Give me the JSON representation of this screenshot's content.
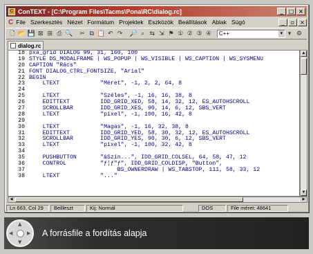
{
  "window": {
    "title": "ConTEXT - [C:\\Program Files\\Tacms\\Pona\\RC\\dialog.rc]",
    "controls": [
      "_",
      "□",
      "×"
    ],
    "doc_controls": [
      "_",
      "▫",
      "×"
    ]
  },
  "menu": {
    "logo": "C",
    "items": [
      "File",
      "Szerkesztés",
      "Nézet",
      "Formátum",
      "Projektek",
      "Eszközök",
      "Beállítások",
      "Ablak",
      "Súgó"
    ]
  },
  "toolbar": {
    "language": "C++"
  },
  "tab": {
    "label": "dialog.rc"
  },
  "code_lines": [
    {
      "n": "18",
      "t": "pxa_grid DIALOG 99, 31, 160, 100"
    },
    {
      "n": "19",
      "t": "STYLE DS_MODALFRAME | WS_POPUP | WS_VISIBLE | WS_CAPTION | WS_SYSMENU"
    },
    {
      "n": "20",
      "t": "CAPTION \"Rács\""
    },
    {
      "n": "21",
      "t": "FONT DIALOG_CTRL_FONTSIZE, \"Arial\""
    },
    {
      "n": "22",
      "t": "BEGIN"
    },
    {
      "n": "23",
      "t": "    LTEXT            \"Méret\", -1, 2, 2, 64, 8"
    },
    {
      "n": "24",
      "t": ""
    },
    {
      "n": "25",
      "t": "    LTEXT            \"Széles\", -1, 16, 16, 38, 8"
    },
    {
      "n": "26",
      "t": "    EDITTEXT         IDD_GRID_XED, 58, 14, 32, 12, ES_AUTOHSCROLL"
    },
    {
      "n": "27",
      "t": "    SCROLLBAR        IDD_GRID_XES, 90, 14, 6, 12, SBS_VERT"
    },
    {
      "n": "28",
      "t": "    LTEXT            \"pixel\", -1, 100, 16, 42, 8"
    },
    {
      "n": "29",
      "t": ""
    },
    {
      "n": "30",
      "t": "    LTEXT            \"Magas\", -1, 16, 32, 38, 8"
    },
    {
      "n": "31",
      "t": "    EDITTEXT         IDD_GRID_YED, 58, 30, 32, 12, ES_AUTOHSCROLL"
    },
    {
      "n": "32",
      "t": "    SCROLLBAR        IDD_GRID_YES, 90, 30, 6, 12, SBS_VERT"
    },
    {
      "n": "33",
      "t": "    LTEXT            \"pixel\", -1, 100, 32, 42, 8"
    },
    {
      "n": "34",
      "t": ""
    },
    {
      "n": "35",
      "t": "    PUSHBUTTON       \"&Szín...\", IDD_GRID_COLSEL, 64, 58, 47, 12"
    },
    {
      "n": "36",
      "t": "    CONTROL          \"ƒ¦ƒ\"ƒ\", IDD_GRID_COLDISP, \"Button\","
    },
    {
      "n": "37",
      "t": "                          BS_OWNERDRAW | WS_TABSTOP, 111, 58, 33, 12"
    },
    {
      "n": "38",
      "t": "    LTEXT            \"...\""
    }
  ],
  "status": {
    "position": "Ln 663, Col 29",
    "mode": "Beilleszt",
    "encoding": "Kij: Normál",
    "format": "DOS",
    "size": "File méret: 48641"
  },
  "caption": {
    "text": "A forrásfile a fordítás alapja"
  }
}
